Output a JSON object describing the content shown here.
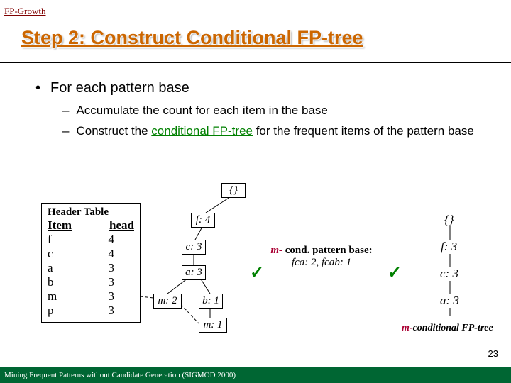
{
  "topic": "FP-Growth",
  "title": "Step 2: Construct Conditional FP-tree",
  "bullets": {
    "level1": "For each pattern base",
    "sub1": "Accumulate the count for each item in the base",
    "sub2_pre": "Construct the ",
    "sub2_green": "conditional FP-tree",
    "sub2_post": " for the frequent items of the pattern base"
  },
  "header_table": {
    "caption": "Header Table",
    "col1": "Item",
    "col2": "head",
    "rows": [
      {
        "item": "f",
        "head": "4"
      },
      {
        "item": "c",
        "head": "4"
      },
      {
        "item": "a",
        "head": "3"
      },
      {
        "item": "b",
        "head": "3"
      },
      {
        "item": "m",
        "head": "3"
      },
      {
        "item": "p",
        "head": "3"
      }
    ]
  },
  "tree": {
    "root": "{}",
    "f4": "f: 4",
    "c3": "c: 3",
    "a3": "a: 3",
    "m2": "m: 2",
    "b1": "b: 1",
    "m1": "m: 1"
  },
  "mbase": {
    "label_m": "m-",
    "label_rest": " cond. pattern base:",
    "values": "fca: 2, fcab: 1"
  },
  "cond_tree": {
    "root": "{}",
    "f3": "f: 3",
    "c3": "c: 3",
    "a3": "a: 3",
    "label_m": "m-",
    "label_rest": "conditional FP-tree"
  },
  "page_num": "23",
  "footer": "Mining Frequent Patterns without Candidate Generation (SIGMOD 2000)",
  "chart_data": {
    "type": "table",
    "title": "Header Table (item support counts in FP-tree)",
    "categories": [
      "f",
      "c",
      "a",
      "b",
      "m",
      "p"
    ],
    "values": [
      4,
      4,
      3,
      3,
      3,
      3
    ]
  }
}
